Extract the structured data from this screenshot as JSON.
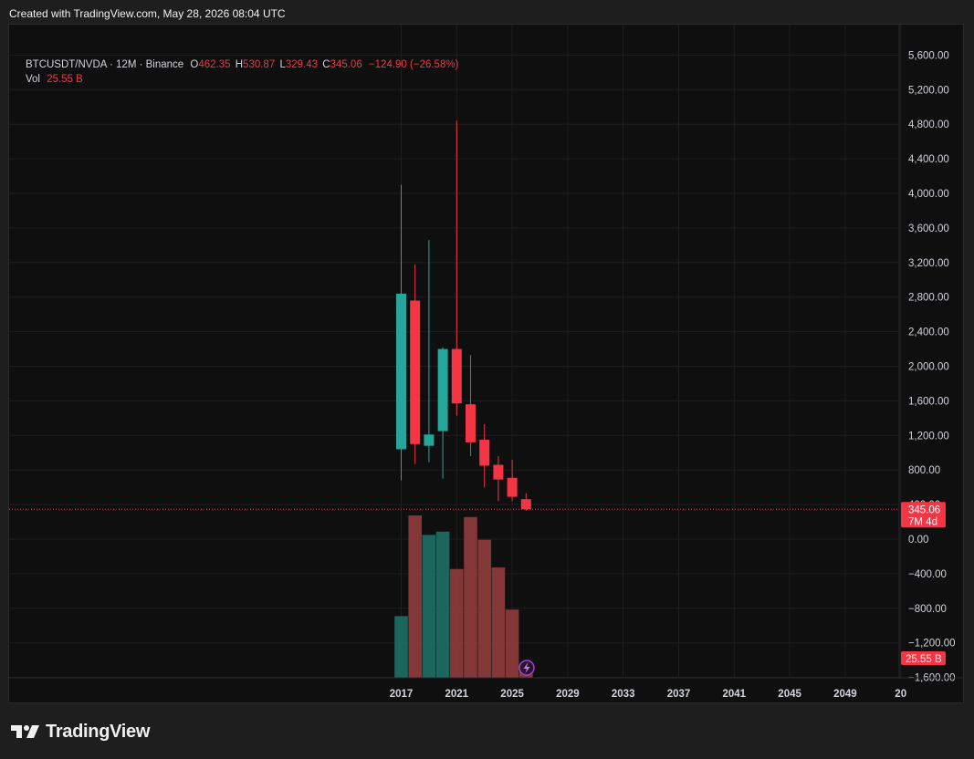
{
  "header": {
    "created_text": "Created with TradingView.com, May 28, 2026 08:04 UTC"
  },
  "legend": {
    "symbol": "BTCUSDT/NVDA · 12M · Binance",
    "o_label": "O",
    "o_value": "462.35",
    "h_label": "H",
    "h_value": "530.87",
    "l_label": "L",
    "l_value": "329.43",
    "c_label": "C",
    "c_value": "345.06",
    "change": "−124.90 (−26.58%)",
    "vol_label": "Vol",
    "vol_value": "25.55 B"
  },
  "price_badge": {
    "price": "345.06",
    "countdown": "7M 4d"
  },
  "volume_badge": "25.55 B",
  "footer": {
    "brand": "TradingView"
  },
  "colors": {
    "up": "#26a69a",
    "down": "#f23645",
    "up_volume": "#1f6b63",
    "down_volume": "#8a3a3a",
    "background": "#0f0f0f",
    "grid": "#1f1f1f"
  },
  "chart_data": {
    "type": "candlestick",
    "y_ticks": [
      "5,600.00",
      "5,200.00",
      "4,800.00",
      "4,400.00",
      "4,000.00",
      "3,600.00",
      "3,200.00",
      "2,800.00",
      "2,400.00",
      "2,000.00",
      "1,600.00",
      "1,200.00",
      "800.00",
      "400.00",
      "0.00",
      "−400.00",
      "−800.00",
      "−1,200.00",
      "−1,600.00"
    ],
    "x_ticks": [
      "2017",
      "2021",
      "2025",
      "2029",
      "2033",
      "2037",
      "2041",
      "2045",
      "2049",
      "20"
    ],
    "ylim": [
      -1600,
      5800
    ],
    "candles": [
      {
        "year": 2017,
        "open": 1040,
        "high": 4100,
        "low": 680,
        "close": 2840
      },
      {
        "year": 2018,
        "open": 2760,
        "high": 3180,
        "low": 870,
        "close": 1100
      },
      {
        "year": 2019,
        "open": 1080,
        "high": 3460,
        "low": 890,
        "close": 1210
      },
      {
        "year": 2020,
        "open": 1250,
        "high": 2220,
        "low": 700,
        "close": 2200
      },
      {
        "year": 2021,
        "open": 2200,
        "high": 4840,
        "low": 1430,
        "close": 1570
      },
      {
        "year": 2022,
        "open": 1560,
        "high": 2130,
        "low": 960,
        "close": 1120
      },
      {
        "year": 2023,
        "open": 1150,
        "high": 1330,
        "low": 600,
        "close": 850
      },
      {
        "year": 2024,
        "open": 860,
        "high": 960,
        "low": 440,
        "close": 690
      },
      {
        "year": 2025,
        "open": 710,
        "high": 920,
        "low": 440,
        "close": 490
      },
      {
        "year": 2026,
        "open": 462.35,
        "high": 530.87,
        "low": 329.43,
        "close": 345.06
      }
    ],
    "volume": [
      {
        "year": 2017,
        "share": 0.38,
        "direction": "up"
      },
      {
        "year": 2018,
        "share": 1.0,
        "direction": "down"
      },
      {
        "year": 2019,
        "share": 0.88,
        "direction": "up"
      },
      {
        "year": 2020,
        "share": 0.9,
        "direction": "up"
      },
      {
        "year": 2021,
        "share": 0.67,
        "direction": "down"
      },
      {
        "year": 2022,
        "share": 0.99,
        "direction": "down"
      },
      {
        "year": 2023,
        "share": 0.85,
        "direction": "down"
      },
      {
        "year": 2024,
        "share": 0.68,
        "direction": "down"
      },
      {
        "year": 2025,
        "share": 0.42,
        "direction": "down"
      },
      {
        "year": 2026,
        "share": 0.05,
        "direction": "down"
      }
    ]
  }
}
